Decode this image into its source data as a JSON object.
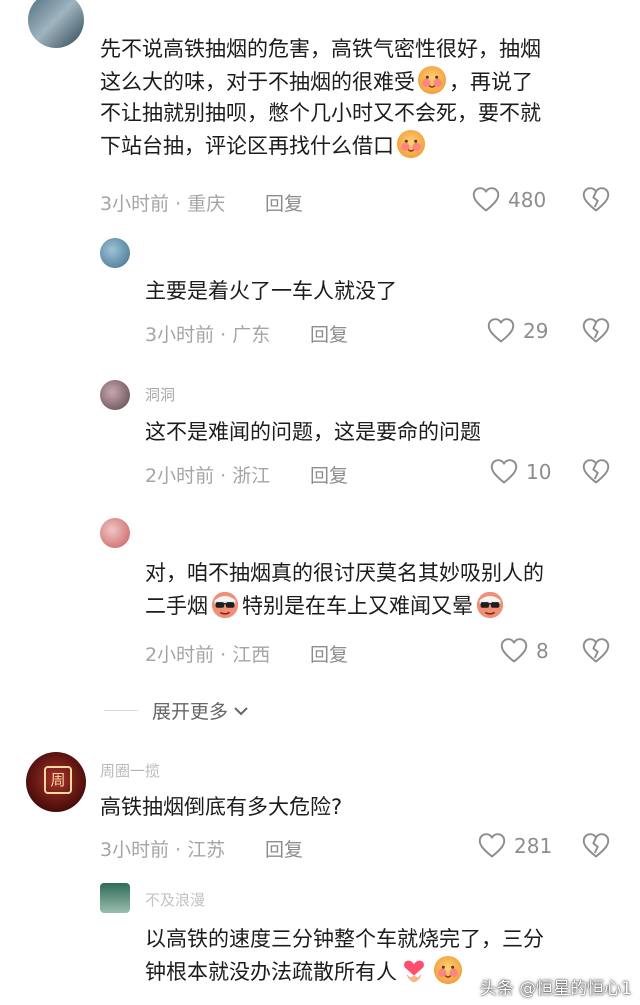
{
  "comments": [
    {
      "name": "",
      "text": [
        "先不说高铁抽烟的危害，高铁气密性很好，抽烟",
        "这么大的味，对于不抽烟的很难受",
        "，再说了",
        "不让抽就别抽呗，憋个几小时又不会死，要不就",
        "下站台抽，评论区再找什么借口"
      ],
      "time": "3小时前",
      "location": "重庆",
      "reply_label": "回复",
      "likes": "480"
    },
    {
      "name": "",
      "text": "主要是着火了一车人就没了",
      "time": "3小时前",
      "location": "广东",
      "reply_label": "回复",
      "likes": "29"
    },
    {
      "name": "洞洞",
      "text": "这不是难闻的问题，这是要命的问题",
      "time": "2小时前",
      "location": "浙江",
      "reply_label": "回复",
      "likes": "10"
    },
    {
      "name": "",
      "text": [
        "对，咱不抽烟真的很讨厌莫名其妙吸别人的",
        "二手烟",
        "特别是在车上又难闻又晕"
      ],
      "time": "2小时前",
      "location": "江西",
      "reply_label": "回复",
      "likes": "8"
    },
    {
      "name": "周圈一揽",
      "text": "高铁抽烟倒底有多大危险?",
      "time": "3小时前",
      "location": "江苏",
      "reply_label": "回复",
      "likes": "281"
    },
    {
      "name": "不及浪漫",
      "text": [
        "以高铁的速度三分钟整个车就烧完了，三分",
        "钟根本就没办法疏散所有人"
      ]
    }
  ],
  "expand_label": "展开更多",
  "watermark": "头条 @恒星的恒心1",
  "colors": {
    "text": "#1c1c1c",
    "meta": "#a5a5a5",
    "accent_red": "#c0392b"
  },
  "icons": [
    "heart-icon",
    "broken-heart-icon",
    "chevron-down-icon",
    "blush-emoji",
    "cool-sunglasses-emoji",
    "heart-hands-emoji"
  ]
}
